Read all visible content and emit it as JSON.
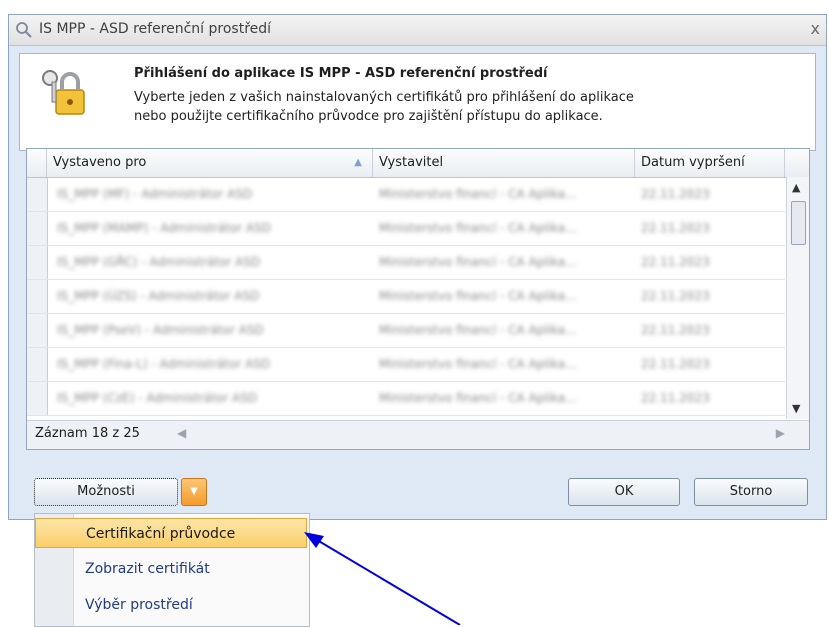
{
  "window": {
    "title": "IS MPP - ASD referenční prostředí",
    "close_label": "x"
  },
  "header": {
    "title": "Přihlášení do aplikace  IS MPP - ASD referenční prostředí",
    "desc_line1": "Vyberte jeden z vašich nainstalovaných certifikátů pro přihlášení do aplikace",
    "desc_line2": "nebo použijte certifikačního průvodce pro zajištění přístupu do aplikace."
  },
  "grid": {
    "columns": [
      "Vystaveno pro",
      "Vystavitel",
      "Datum vypršení"
    ],
    "rows": [
      [
        "IS_MPP (MF) - Administrátor ASD",
        "Ministerstvo financí - CA Aplika...",
        "22.11.2023"
      ],
      [
        "IS_MPP (MAMP) - Administrátor ASD",
        "Ministerstvo financí - CA Aplika...",
        "22.11.2023"
      ],
      [
        "IS_MPP (GŘC) - Administrátor ASD",
        "Ministerstvo financí - CA Aplika...",
        "22.11.2023"
      ],
      [
        "IS_MPP (ÚZS) - Administrátor ASD",
        "Ministerstvo financí - CA Aplika...",
        "22.11.2023"
      ],
      [
        "IS_MPP (PseV) - Administrátor ASD",
        "Ministerstvo financí - CA Aplika...",
        "22.11.2023"
      ],
      [
        "IS_MPP (Fina-L) - Administrátor ASD",
        "Ministerstvo financí - CA Aplika...",
        "22.11.2023"
      ],
      [
        "IS_MPP (CzE) - Administrátor ASD",
        "Ministerstvo financí - CA Aplika...",
        "22.11.2023"
      ]
    ],
    "record_label": "Záznam 18 z 25"
  },
  "buttons": {
    "options": "Možnosti",
    "ok": "OK",
    "cancel": "Storno"
  },
  "menu": {
    "items": [
      "Certifikační průvodce",
      "Zobrazit certifikát",
      "Výběr prostředí"
    ],
    "active_index": 0
  },
  "colors": {
    "accent_orange": "#f59b2d",
    "arrow": "#0000e0"
  }
}
